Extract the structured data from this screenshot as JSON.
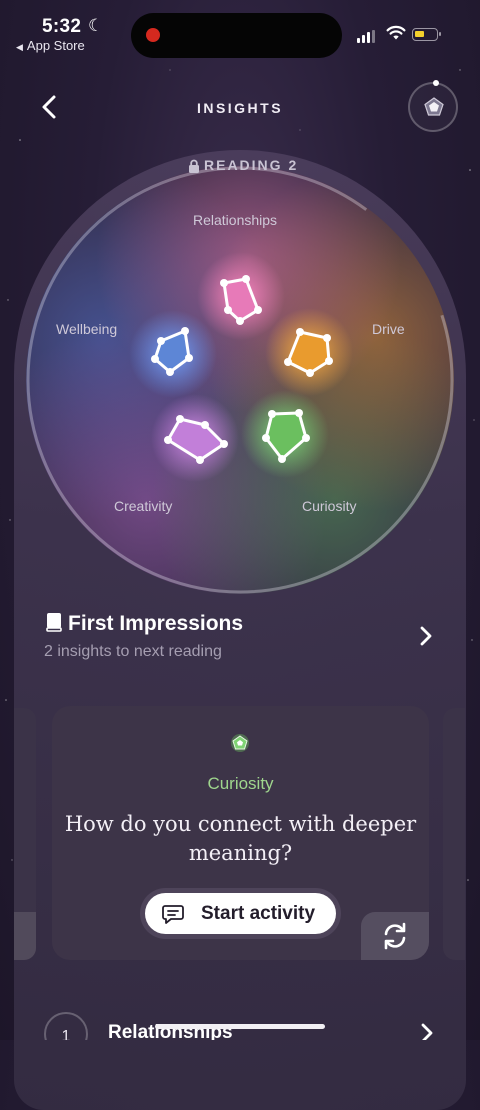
{
  "status_bar": {
    "time": "5:32",
    "back_app": "App Store"
  },
  "header": {
    "title": "INSIGHTS"
  },
  "wheel": {
    "reading_label": "READING 2",
    "categories": {
      "relationships": "Relationships",
      "drive": "Drive",
      "wellbeing": "Wellbeing",
      "creativity": "Creativity",
      "curiosity": "Curiosity"
    },
    "colors": {
      "relationships": "#ff7ab8",
      "drive": "#ffb13b",
      "wellbeing": "#6ea0ff",
      "creativity": "#d98cf0",
      "curiosity": "#7ee07a"
    }
  },
  "first_impressions": {
    "title": "First Impressions",
    "subtitle": "2 insights to next reading"
  },
  "activity_card": {
    "category": "Curiosity",
    "question": "How do you connect with deeper meaning?",
    "button_label": "Start activity",
    "category_color": "#9fd58d"
  },
  "list": {
    "items": [
      {
        "number": "1",
        "label": "Relationships"
      }
    ]
  }
}
